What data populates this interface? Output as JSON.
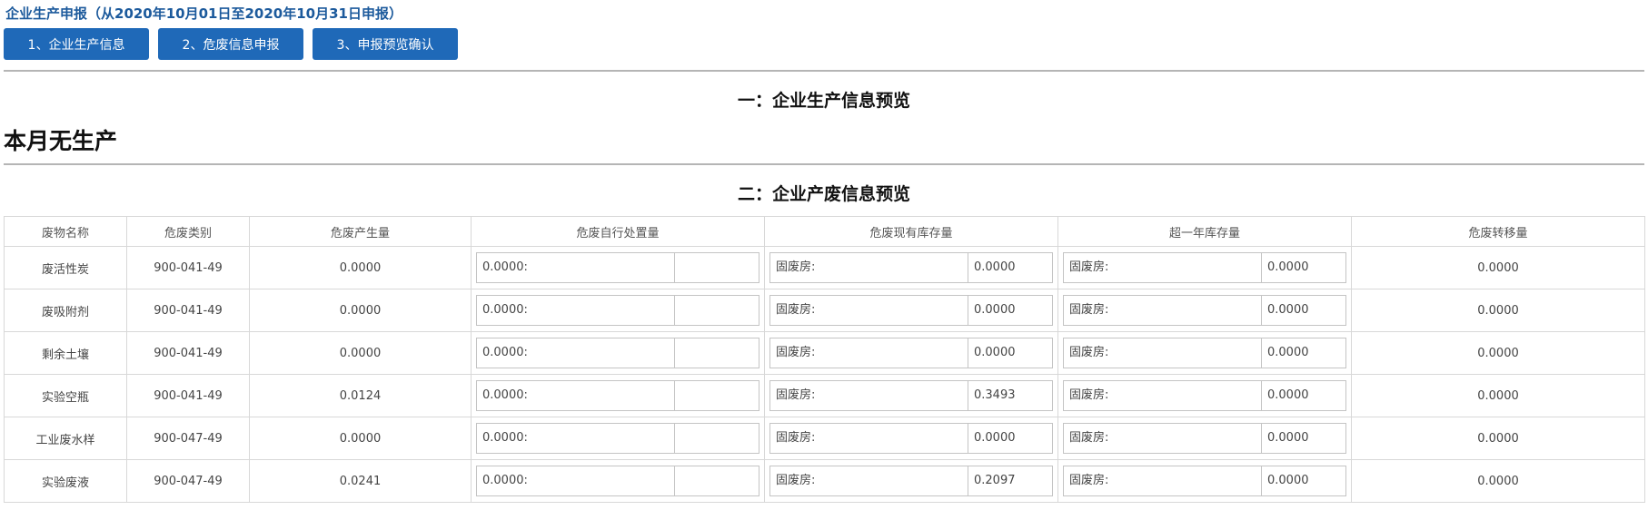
{
  "header": {
    "title": "企业生产申报（从2020年10月01日至2020年10月31日申报）"
  },
  "steps": [
    {
      "label": "1、企业生产信息"
    },
    {
      "label": "2、危废信息申报"
    },
    {
      "label": "3、申报预览确认"
    }
  ],
  "section1": {
    "title": "一：企业生产信息预览",
    "no_production": "本月无生产"
  },
  "section2": {
    "title": "二：企业产废信息预览"
  },
  "table": {
    "headers": [
      "废物名称",
      "危废类别",
      "危废产生量",
      "危废自行处置量",
      "危废现有库存量",
      "超一年库存量",
      "危废转移量"
    ],
    "rows": [
      {
        "name": "废活性炭",
        "category": "900-041-49",
        "produced": "0.0000",
        "self_disposal_label": "0.0000:",
        "self_disposal_value": "",
        "stock_label": "固废房:",
        "stock_value": "0.0000",
        "over_year_label": "固废房:",
        "over_year_value": "0.0000",
        "transfer": "0.0000"
      },
      {
        "name": "废吸附剂",
        "category": "900-041-49",
        "produced": "0.0000",
        "self_disposal_label": "0.0000:",
        "self_disposal_value": "",
        "stock_label": "固废房:",
        "stock_value": "0.0000",
        "over_year_label": "固废房:",
        "over_year_value": "0.0000",
        "transfer": "0.0000"
      },
      {
        "name": "剩余土壤",
        "category": "900-041-49",
        "produced": "0.0000",
        "self_disposal_label": "0.0000:",
        "self_disposal_value": "",
        "stock_label": "固废房:",
        "stock_value": "0.0000",
        "over_year_label": "固废房:",
        "over_year_value": "0.0000",
        "transfer": "0.0000"
      },
      {
        "name": "实验空瓶",
        "category": "900-041-49",
        "produced": "0.0124",
        "self_disposal_label": "0.0000:",
        "self_disposal_value": "",
        "stock_label": "固废房:",
        "stock_value": "0.3493",
        "over_year_label": "固废房:",
        "over_year_value": "0.0000",
        "transfer": "0.0000"
      },
      {
        "name": "工业废水样",
        "category": "900-047-49",
        "produced": "0.0000",
        "self_disposal_label": "0.0000:",
        "self_disposal_value": "",
        "stock_label": "固废房:",
        "stock_value": "0.0000",
        "over_year_label": "固废房:",
        "over_year_value": "0.0000",
        "transfer": "0.0000"
      },
      {
        "name": "实验废液",
        "category": "900-047-49",
        "produced": "0.0241",
        "self_disposal_label": "0.0000:",
        "self_disposal_value": "",
        "stock_label": "固废房:",
        "stock_value": "0.2097",
        "over_year_label": "固废房:",
        "over_year_value": "0.0000",
        "transfer": "0.0000"
      }
    ]
  }
}
